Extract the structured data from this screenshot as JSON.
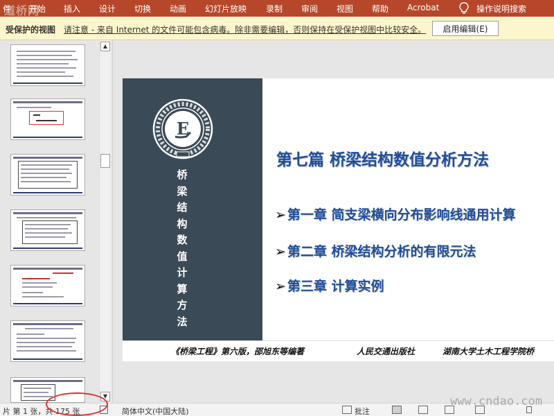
{
  "ribbon": {
    "logo_text": "道桥网",
    "file_fragment": "件",
    "tabs": [
      "开始",
      "插入",
      "设计",
      "切换",
      "动画",
      "幻灯片放映",
      "录制",
      "审阅",
      "视图",
      "帮助",
      "Acrobat"
    ],
    "search_label": "操作说明搜索",
    "bg_color": "#b7472a"
  },
  "protected_view": {
    "title": "受保护的视图",
    "message": "请注意 - 来自 Internet 的文件可能包含病毒。除非需要编辑，否则保持在受保护视图中比较安全。",
    "enable_button": "启用编辑(E)"
  },
  "slide": {
    "vertical_title": [
      "桥",
      "梁",
      "结",
      "构",
      "数",
      "值",
      "计",
      "算",
      "方",
      "法"
    ],
    "title": "第七篇  桥梁结构数值分析方法",
    "chapters": [
      "第一章 简支梁横向分布影响线通用计算",
      "第二章 桥梁结构分析的有限元法",
      "第三章 计算实例"
    ],
    "bullet": "➢",
    "footer": [
      "《桥梁工程》第六版，邵旭东等编著",
      "人民交通出版社",
      "湖南大学土木工程学院桥"
    ],
    "emblem_letter": "E",
    "panel_color": "#3b4a57",
    "title_color": "#1f4e9c"
  },
  "statusbar": {
    "slide_counter": "片 第 1 张，共 175 张",
    "language": "简体中文(中国大陆)",
    "comments": "批注",
    "watermark": "www.cndao.com"
  }
}
